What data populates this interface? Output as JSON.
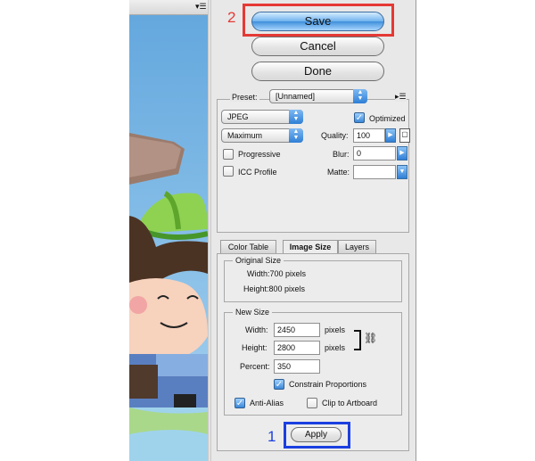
{
  "colors": {
    "accent_blue": "#3f8fdb",
    "annotation_red": "#e53935",
    "annotation_blue": "#1b3fe0"
  },
  "buttons": {
    "save": "Save",
    "cancel": "Cancel",
    "done": "Done"
  },
  "preset": {
    "label": "Preset:",
    "value": "[Unnamed]"
  },
  "format": {
    "value": "JPEG"
  },
  "quality_preset": {
    "value": "Maximum"
  },
  "optimized": {
    "label": "Optimized",
    "checked": true
  },
  "quality": {
    "label": "Quality:",
    "value": "100"
  },
  "progressive": {
    "label": "Progressive",
    "checked": false
  },
  "blur": {
    "label": "Blur:",
    "value": "0"
  },
  "icc": {
    "label": "ICC Profile",
    "checked": false
  },
  "matte": {
    "label": "Matte:",
    "value": ""
  },
  "tabs": [
    {
      "label": "Color Table"
    },
    {
      "label": "Image Size"
    },
    {
      "label": "Layers"
    }
  ],
  "original_size": {
    "title": "Original Size",
    "width": "Width:700 pixels",
    "height": "Height:800 pixels"
  },
  "new_size": {
    "title": "New Size",
    "width_label": "Width:",
    "width_value": "2450",
    "width_unit": "pixels",
    "height_label": "Height:",
    "height_value": "2800",
    "height_unit": "pixels",
    "percent_label": "Percent:",
    "percent_value": "350"
  },
  "constrain": {
    "label": "Constrain Proportions",
    "checked": true
  },
  "anti_alias": {
    "label": "Anti-Alias",
    "checked": true
  },
  "clip": {
    "label": "Clip to Artboard",
    "checked": false
  },
  "apply": {
    "label": "Apply"
  },
  "annotations": {
    "step1": "1",
    "step2": "2"
  }
}
